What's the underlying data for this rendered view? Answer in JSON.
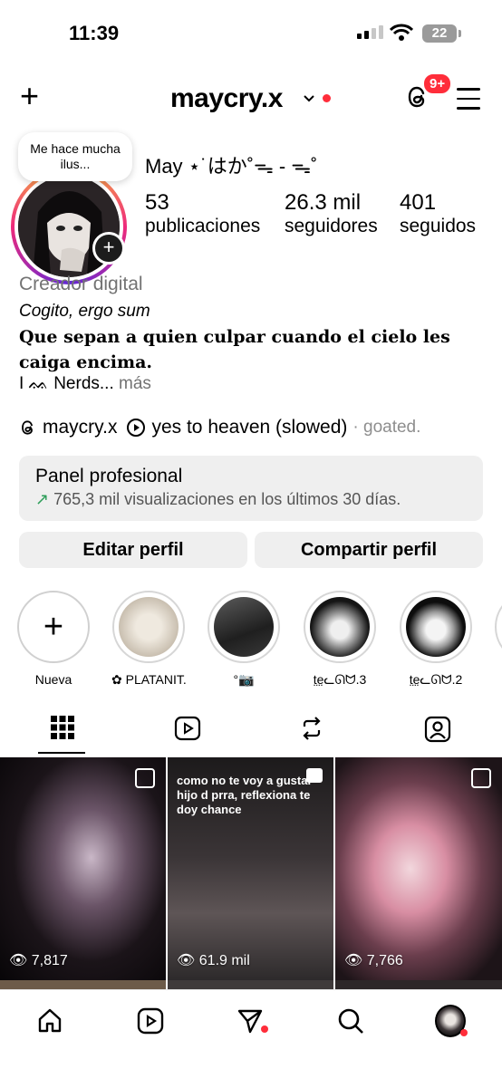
{
  "status_bar": {
    "time": "11:39",
    "battery": "22"
  },
  "header": {
    "username": "maycry.x",
    "notification_badge": "9+"
  },
  "profile": {
    "note": "Me hace mucha ilus...",
    "display_name": "May ⋆˙はか˚ᯓ - ᯓ˚",
    "stats": [
      {
        "value": "53",
        "label": "publicaciones"
      },
      {
        "value": "26.3 mil",
        "label": "seguidores"
      },
      {
        "value": "401",
        "label": "seguidos"
      }
    ],
    "category": "Creador digital",
    "bio_line1": "Cogito, ergo sum",
    "bio_line2": "Que sepan a quien culpar cuando el cielo les caiga encima.",
    "bio_line3_text": "I ᨐ Nerds...",
    "bio_more": "más",
    "threads_handle": "maycry.x",
    "music_title": "yes to heaven (slowed)",
    "music_suffix": "· goated."
  },
  "panel": {
    "title": "Panel profesional",
    "subtitle": "765,3 mil visualizaciones en los últimos 30 días."
  },
  "buttons": {
    "edit": "Editar perfil",
    "share": "Compartir perfil"
  },
  "highlights": [
    {
      "label": "Nueva"
    },
    {
      "label": "✿ PLATANIT..."
    },
    {
      "label": "°📷"
    },
    {
      "label": "t̤e̤ᓚᘏᗢ.3"
    },
    {
      "label": "t̤e̤ᓚᘏᗢ.2"
    }
  ],
  "posts": [
    {
      "views": "7,817"
    },
    {
      "views": "61.9 mil",
      "caption": "como no te voy a gustar hijo d prra, reflexiona te doy chance"
    },
    {
      "views": "7,766"
    }
  ],
  "colors": {
    "accent_red": "#ff2d3a",
    "panel_bg": "#efefef",
    "trend_green": "#2e9e5a"
  }
}
